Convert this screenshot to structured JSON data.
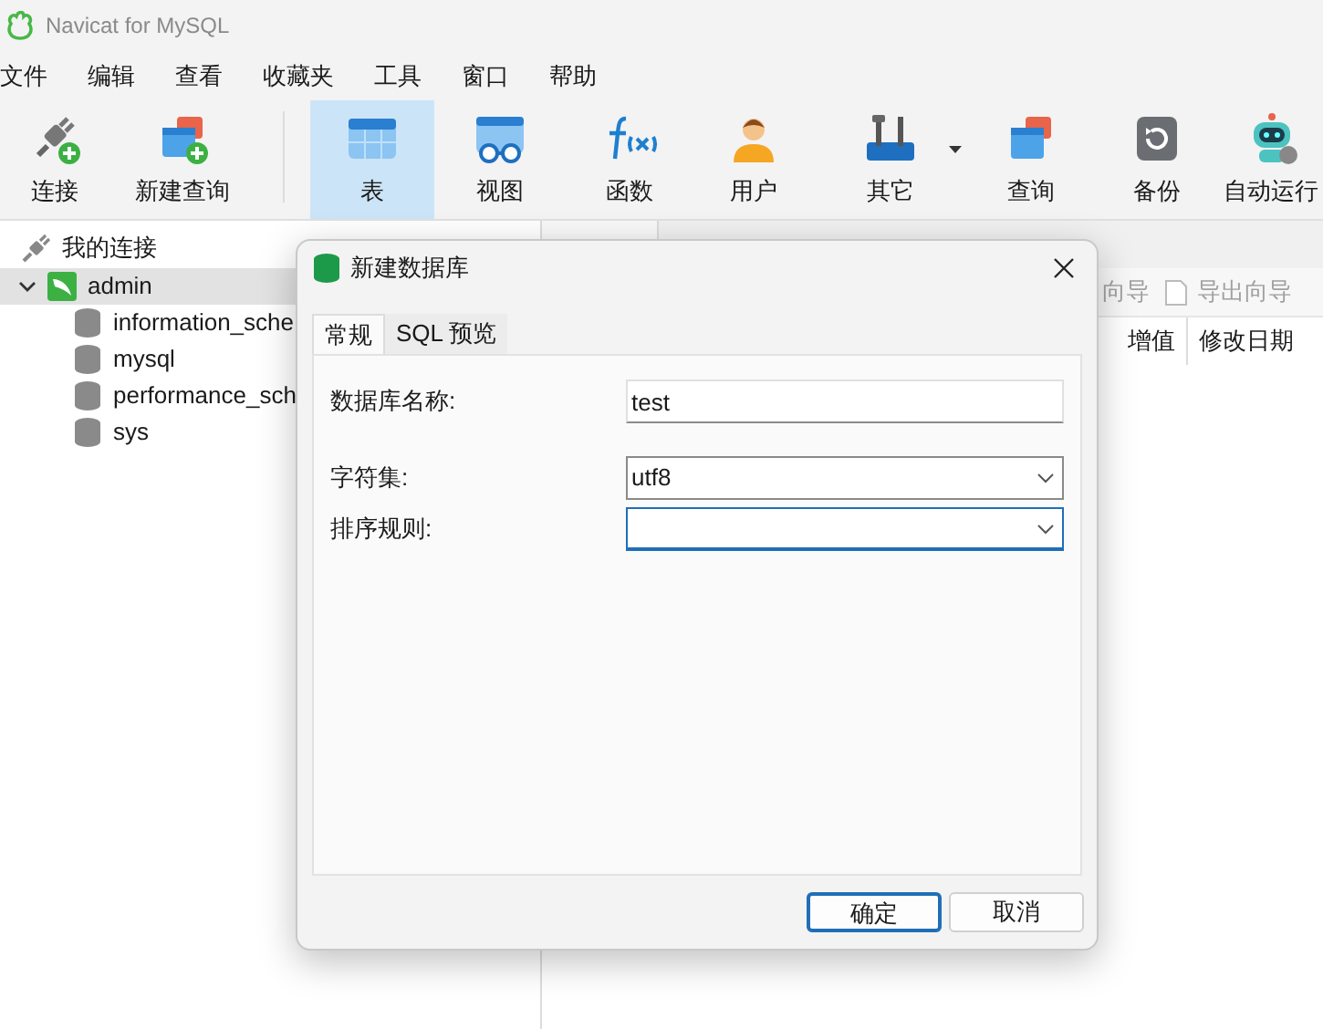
{
  "window": {
    "title": "Navicat for MySQL"
  },
  "menu": [
    "文件",
    "编辑",
    "查看",
    "收藏夹",
    "工具",
    "窗口",
    "帮助"
  ],
  "toolbar": [
    {
      "kind": "connect",
      "label": "连接",
      "selected": false,
      "has_menu": false
    },
    {
      "kind": "new-query",
      "label": "新建查询",
      "selected": false,
      "has_menu": false
    },
    {
      "kind": "table",
      "label": "表",
      "selected": true,
      "has_menu": false
    },
    {
      "kind": "view",
      "label": "视图",
      "selected": false,
      "has_menu": false
    },
    {
      "kind": "function",
      "label": "函数",
      "selected": false,
      "has_menu": false
    },
    {
      "kind": "user",
      "label": "用户",
      "selected": false,
      "has_menu": false
    },
    {
      "kind": "tools",
      "label": "其它",
      "selected": false,
      "has_menu": true
    },
    {
      "kind": "query",
      "label": "查询",
      "selected": false,
      "has_menu": false
    },
    {
      "kind": "backup",
      "label": "备份",
      "selected": false,
      "has_menu": false
    },
    {
      "kind": "robot",
      "label": "自动运行",
      "selected": false,
      "has_menu": false
    }
  ],
  "sidebar": {
    "header": "我的连接",
    "items": [
      {
        "label": "admin",
        "expanded": true,
        "selected": true,
        "children": [
          {
            "label": "information_sche"
          },
          {
            "label": "mysql"
          },
          {
            "label": "performance_sch"
          },
          {
            "label": "sys"
          }
        ]
      }
    ]
  },
  "object_toolbar": [
    {
      "label": "向导",
      "icon": false
    },
    {
      "label": "导出向导",
      "icon": true
    }
  ],
  "table": {
    "columns": [
      "增值",
      "修改日期"
    ]
  },
  "dialog": {
    "title": "新建数据库",
    "tabs": [
      {
        "label": "常规",
        "selected": true
      },
      {
        "label": "SQL 预览",
        "selected": false
      }
    ],
    "fields": [
      {
        "kind": "text",
        "label": "数据库名称:",
        "value": "test",
        "focused": false
      },
      {
        "kind": "select",
        "label": "字符集:",
        "value": "utf8",
        "focused": false
      },
      {
        "kind": "select",
        "label": "排序规则:",
        "focused": true
      }
    ],
    "buttons": [
      {
        "label": "确定",
        "default": true
      },
      {
        "label": "取消",
        "default": false
      }
    ]
  }
}
